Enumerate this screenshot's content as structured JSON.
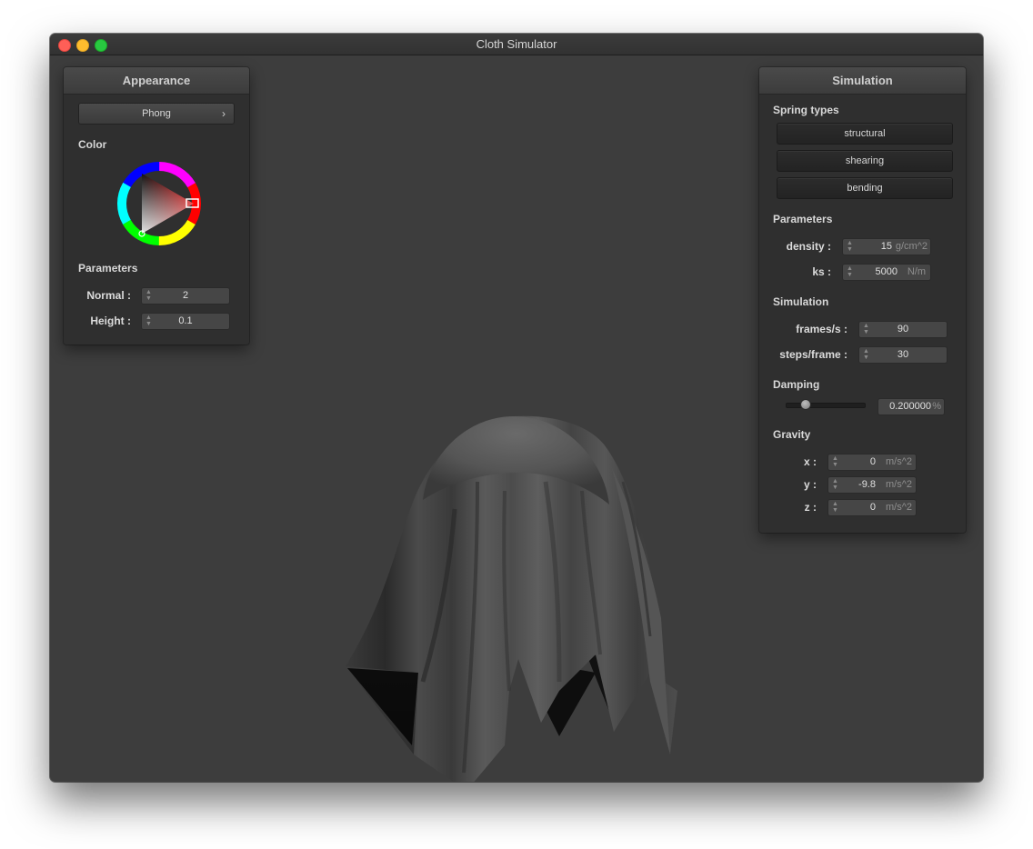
{
  "window": {
    "title": "Cloth Simulator"
  },
  "appearance_panel": {
    "header": "Appearance",
    "shader_combo": "Phong",
    "color_label": "Color",
    "color_selected": "#e03030",
    "parameters_label": "Parameters",
    "fields": [
      {
        "label": "Normal :",
        "value": "2"
      },
      {
        "label": "Height :",
        "value": "0.1"
      }
    ]
  },
  "simulation_panel": {
    "header": "Simulation",
    "spring_types_label": "Spring types",
    "spring_buttons": [
      "structural",
      "shearing",
      "bending"
    ],
    "parameters_label": "Parameters",
    "params": [
      {
        "label": "density :",
        "value": "15",
        "unit": "g/cm^2"
      },
      {
        "label": "ks :",
        "value": "5000",
        "unit": "N/m"
      }
    ],
    "simulation_label": "Simulation",
    "sim_fields": [
      {
        "label": "frames/s :",
        "value": "90"
      },
      {
        "label": "steps/frame :",
        "value": "30"
      }
    ],
    "damping_label": "Damping",
    "damping": {
      "slider_fraction": 0.2,
      "value": "0.200000",
      "unit": "%"
    },
    "gravity_label": "Gravity",
    "gravity": [
      {
        "label": "x :",
        "value": "0",
        "unit": "m/s^2"
      },
      {
        "label": "y :",
        "value": "-9.8",
        "unit": "m/s^2"
      },
      {
        "label": "z :",
        "value": "0",
        "unit": "m/s^2"
      }
    ]
  },
  "colors": {
    "viewport_bg": "#3d3d3d",
    "panel_bg": "#2f2f2f",
    "cloth": "#4a4a4a"
  }
}
